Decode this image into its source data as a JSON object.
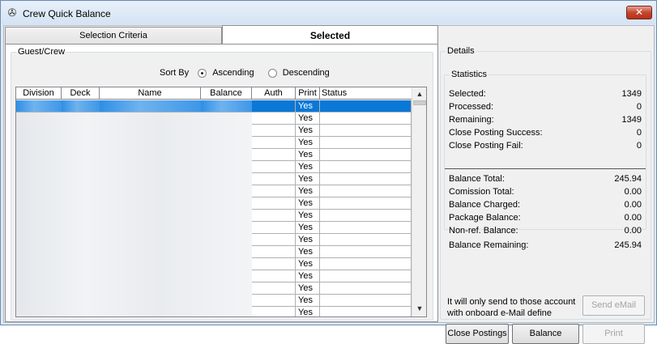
{
  "window": {
    "title": "Crew Quick Balance",
    "close_label": "✕"
  },
  "tabs": [
    {
      "label": "Selection Criteria"
    },
    {
      "label": "Selected"
    }
  ],
  "guest_group": {
    "legend": "Guest/Crew",
    "sort_by_label": "Sort By",
    "ascending_label": "Ascending",
    "descending_label": "Descending",
    "sort_selected": "ascending"
  },
  "table": {
    "columns": [
      "Division",
      "Deck",
      "Name",
      "Balance",
      "Auth",
      "Print",
      "Status"
    ],
    "rows": [
      {
        "print": "Yes",
        "status": ""
      },
      {
        "print": "Yes",
        "status": ""
      },
      {
        "print": "Yes",
        "status": ""
      },
      {
        "print": "Yes",
        "status": ""
      },
      {
        "print": "Yes",
        "status": ""
      },
      {
        "print": "Yes",
        "status": ""
      },
      {
        "print": "Yes",
        "status": ""
      },
      {
        "print": "Yes",
        "status": ""
      },
      {
        "print": "Yes",
        "status": ""
      },
      {
        "print": "Yes",
        "status": ""
      },
      {
        "print": "Yes",
        "status": ""
      },
      {
        "print": "Yes",
        "status": ""
      },
      {
        "print": "Yes",
        "status": ""
      },
      {
        "print": "Yes",
        "status": ""
      },
      {
        "print": "Yes",
        "status": ""
      },
      {
        "print": "Yes",
        "status": ""
      },
      {
        "print": "Yes",
        "status": ""
      },
      {
        "print": "Yes",
        "status": ""
      }
    ]
  },
  "details": {
    "legend": "Details",
    "stats_legend": "Statistics",
    "stats": [
      {
        "label": "Selected:",
        "value": "1349"
      },
      {
        "label": "Processed:",
        "value": "0"
      },
      {
        "label": "Remaining:",
        "value": "1349"
      },
      {
        "label": "Close Posting Success:",
        "value": "0"
      },
      {
        "label": "Close Posting Fail:",
        "value": "0"
      }
    ],
    "totals": [
      {
        "label": "Balance Total:",
        "value": "245.94"
      },
      {
        "label": "Comission Total:",
        "value": "0.00"
      },
      {
        "label": "Balance Charged:",
        "value": "0.00"
      },
      {
        "label": "Package Balance:",
        "value": "0.00"
      },
      {
        "label": "Non-ref. Balance:",
        "value": "0.00"
      },
      {
        "label": "Balance Remaining:",
        "value": "245.94"
      }
    ],
    "hint": "It will only send to those account with onboard e-Mail define",
    "buttons": {
      "send_email": "Send eMail",
      "close_postings": "Close Postings",
      "balance": "Balance",
      "print": "Print"
    }
  },
  "colors": {
    "selection": "#0a78d7",
    "window_border": "#6d8db1"
  }
}
